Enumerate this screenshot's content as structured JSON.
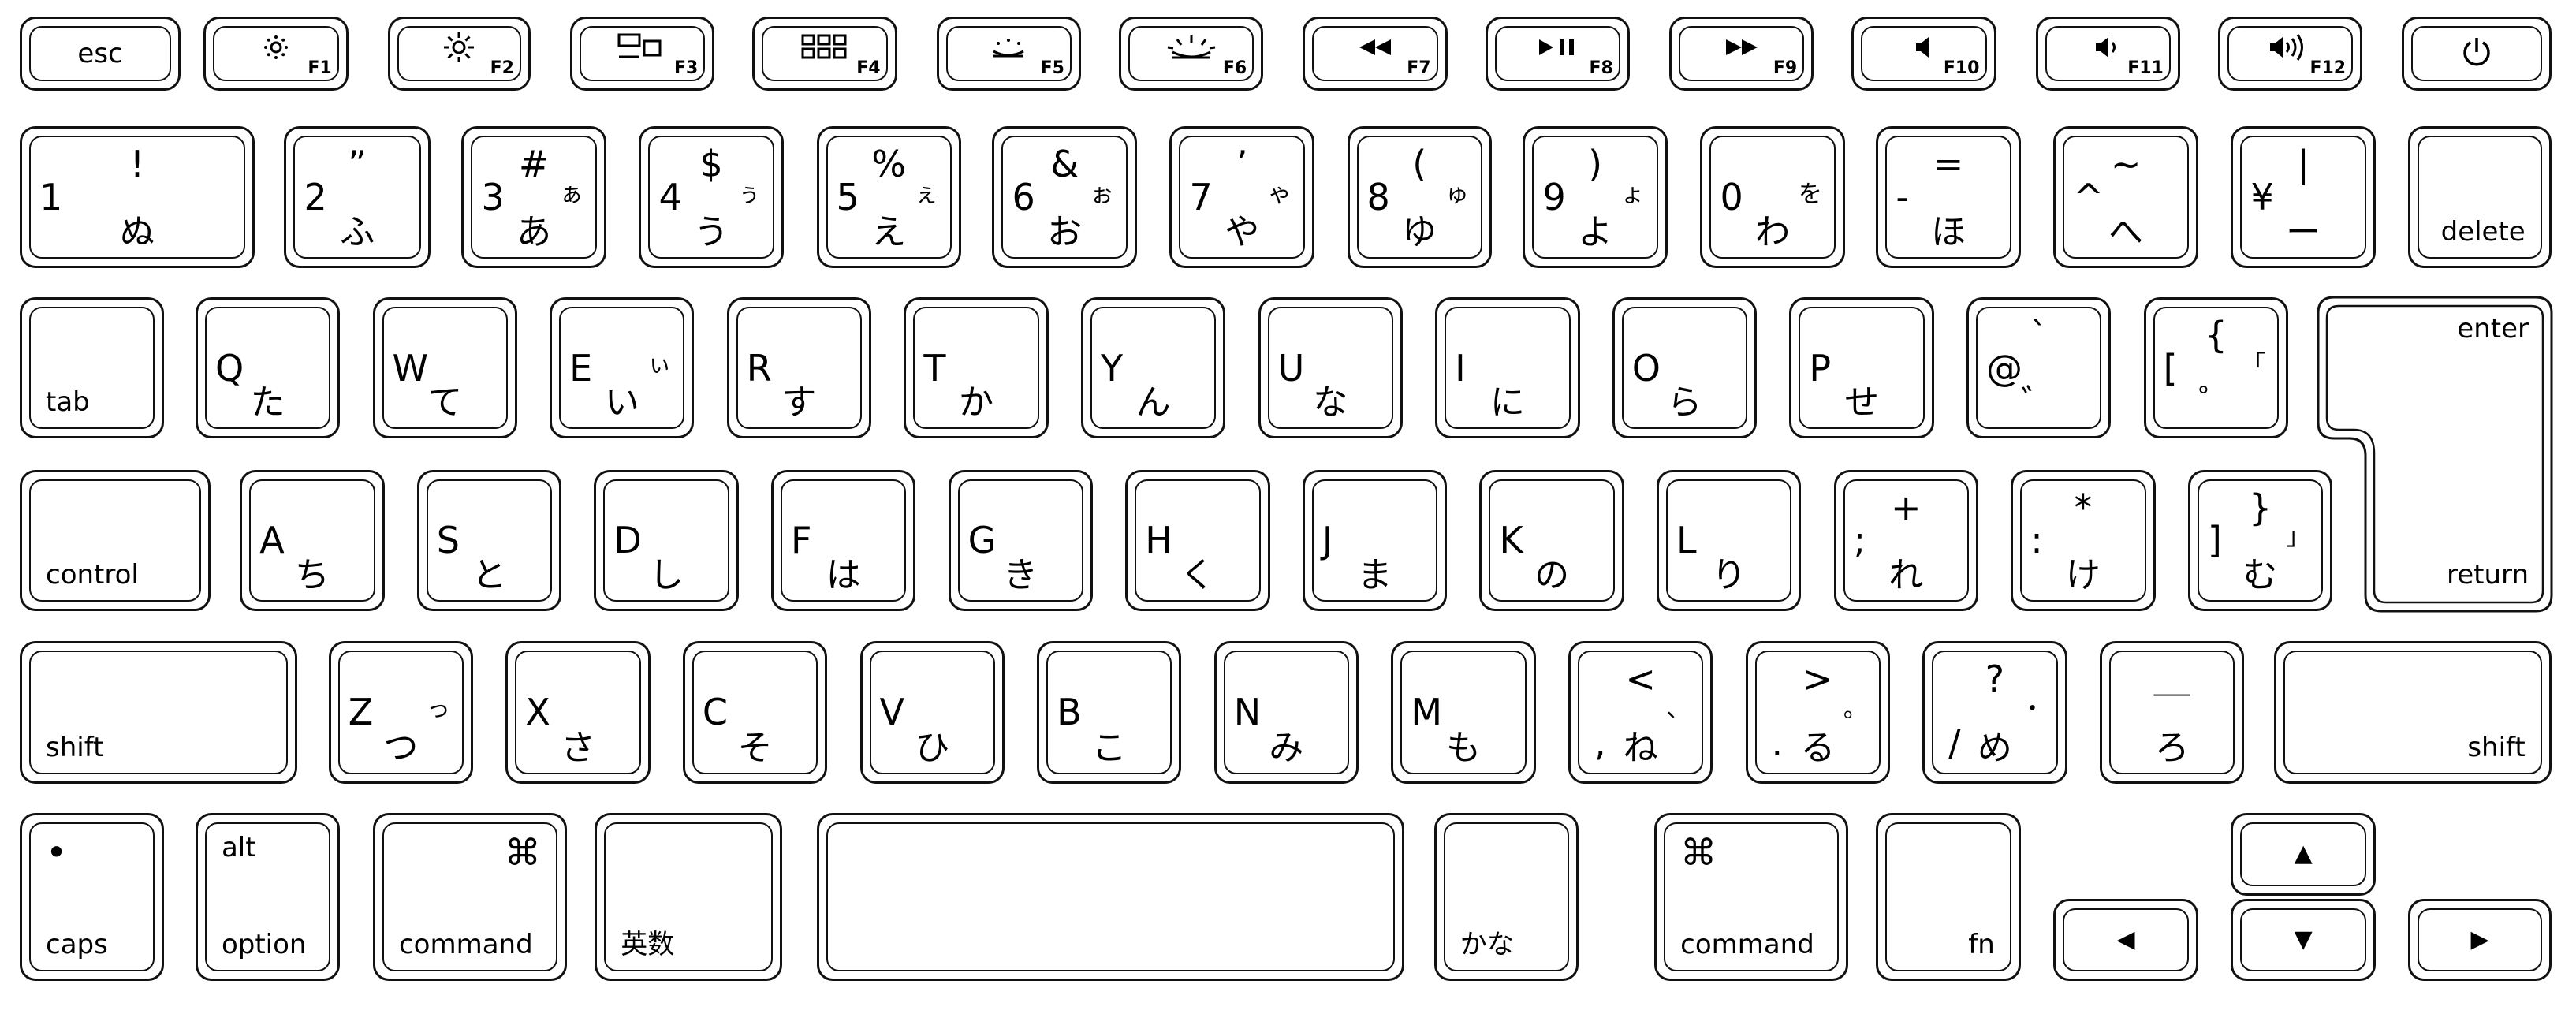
{
  "keyboard_layout": "Japanese JIS",
  "rows": [
    [
      {
        "name": "esc",
        "labels": {
          "c": "esc"
        }
      },
      {
        "name": "f1",
        "icon": "brightness-down-icon",
        "labels": {
          "fn": "F1"
        }
      },
      {
        "name": "f2",
        "icon": "brightness-up-icon",
        "labels": {
          "fn": "F2"
        }
      },
      {
        "name": "f3",
        "icon": "mission-control-icon",
        "labels": {
          "fn": "F3"
        }
      },
      {
        "name": "f4",
        "icon": "launchpad-icon",
        "labels": {
          "fn": "F4"
        }
      },
      {
        "name": "f5",
        "icon": "keyboard-light-down-icon",
        "labels": {
          "fn": "F5"
        }
      },
      {
        "name": "f6",
        "icon": "keyboard-light-up-icon",
        "labels": {
          "fn": "F6"
        }
      },
      {
        "name": "f7",
        "icon": "rewind-icon",
        "labels": {
          "fn": "F7"
        }
      },
      {
        "name": "f8",
        "icon": "play-pause-icon",
        "labels": {
          "fn": "F8"
        }
      },
      {
        "name": "f9",
        "icon": "fast-forward-icon",
        "labels": {
          "fn": "F9"
        }
      },
      {
        "name": "f10",
        "icon": "mute-icon",
        "labels": {
          "fn": "F10"
        }
      },
      {
        "name": "f11",
        "icon": "volume-down-icon",
        "labels": {
          "fn": "F11"
        }
      },
      {
        "name": "f12",
        "icon": "volume-up-icon",
        "labels": {
          "fn": "F12"
        }
      },
      {
        "name": "power",
        "icon": "power-icon",
        "labels": {}
      }
    ],
    [
      {
        "name": "1",
        "labels": {
          "tc": "!",
          "ml": "1",
          "bc": "ぬ"
        }
      },
      {
        "name": "2",
        "labels": {
          "tc": "”",
          "ml": "2",
          "bc": "ふ"
        }
      },
      {
        "name": "3",
        "labels": {
          "tc": "#",
          "ml": "3",
          "bc": "あ",
          "mr": "ぁ"
        }
      },
      {
        "name": "4",
        "labels": {
          "tc": "$",
          "ml": "4",
          "bc": "う",
          "mr": "ぅ"
        }
      },
      {
        "name": "5",
        "labels": {
          "tc": "%",
          "ml": "5",
          "bc": "え",
          "mr": "ぇ"
        }
      },
      {
        "name": "6",
        "labels": {
          "tc": "&",
          "ml": "6",
          "bc": "お",
          "mr": "ぉ"
        }
      },
      {
        "name": "7",
        "labels": {
          "tc": "’",
          "ml": "7",
          "bc": "や",
          "mr": "ゃ"
        }
      },
      {
        "name": "8",
        "labels": {
          "tc": "(",
          "ml": "8",
          "bc": "ゆ",
          "mr": "ゅ"
        }
      },
      {
        "name": "9",
        "labels": {
          "tc": ")",
          "ml": "9",
          "bc": "よ",
          "mr": "ょ"
        }
      },
      {
        "name": "0",
        "labels": {
          "ml": "0",
          "bc": "わ",
          "mr": "を"
        }
      },
      {
        "name": "minus",
        "labels": {
          "tc": "=",
          "ml": "-",
          "bc": "ほ"
        }
      },
      {
        "name": "caret",
        "labels": {
          "tc": "~",
          "ml": "^",
          "bc": "へ"
        }
      },
      {
        "name": "yen",
        "labels": {
          "tc": "|",
          "ml": "¥",
          "bc": "ー"
        }
      },
      {
        "name": "delete",
        "labels": {
          "br": "delete"
        }
      }
    ],
    [
      {
        "name": "tab",
        "labels": {
          "bl": "tab"
        }
      },
      {
        "name": "q",
        "labels": {
          "ml": "Q",
          "bc": "た"
        }
      },
      {
        "name": "w",
        "labels": {
          "ml": "W",
          "bc": "て"
        }
      },
      {
        "name": "e",
        "labels": {
          "ml": "E",
          "bc": "い",
          "mr": "ぃ"
        }
      },
      {
        "name": "r",
        "labels": {
          "ml": "R",
          "bc": "す"
        }
      },
      {
        "name": "t",
        "labels": {
          "ml": "T",
          "bc": "か"
        }
      },
      {
        "name": "y",
        "labels": {
          "ml": "Y",
          "bc": "ん"
        }
      },
      {
        "name": "u",
        "labels": {
          "ml": "U",
          "bc": "な"
        }
      },
      {
        "name": "i",
        "labels": {
          "ml": "I",
          "bc": "に"
        }
      },
      {
        "name": "o",
        "labels": {
          "ml": "O",
          "bc": "ら"
        }
      },
      {
        "name": "p",
        "labels": {
          "ml": "P",
          "bc": "せ"
        }
      },
      {
        "name": "at",
        "labels": {
          "tc": "`",
          "ml": "@",
          "bc": "゛"
        }
      },
      {
        "name": "bracket-left",
        "labels": {
          "tc": "{",
          "ml": "[",
          "mr": "「",
          "bc": "゜"
        }
      }
    ],
    [
      {
        "name": "control",
        "labels": {
          "bl": "control"
        }
      },
      {
        "name": "a",
        "labels": {
          "ml": "A",
          "bc": "ち"
        }
      },
      {
        "name": "s",
        "labels": {
          "ml": "S",
          "bc": "と"
        }
      },
      {
        "name": "d",
        "labels": {
          "ml": "D",
          "bc": "し"
        }
      },
      {
        "name": "f",
        "labels": {
          "ml": "F",
          "bc": "は"
        }
      },
      {
        "name": "g",
        "labels": {
          "ml": "G",
          "bc": "き"
        }
      },
      {
        "name": "h",
        "labels": {
          "ml": "H",
          "bc": "く"
        }
      },
      {
        "name": "j",
        "labels": {
          "ml": "J",
          "bc": "ま"
        }
      },
      {
        "name": "k",
        "labels": {
          "ml": "K",
          "bc": "の"
        }
      },
      {
        "name": "l",
        "labels": {
          "ml": "L",
          "bc": "り"
        }
      },
      {
        "name": "semicolon",
        "labels": {
          "tc": "+",
          "ml": ";",
          "bc": "れ"
        }
      },
      {
        "name": "colon",
        "labels": {
          "tc": "*",
          "ml": ":",
          "bc": "け"
        }
      },
      {
        "name": "bracket-right",
        "labels": {
          "tc": "}",
          "ml": "]",
          "mr": "」",
          "bc": "む"
        }
      }
    ],
    [
      {
        "name": "shift-left",
        "labels": {
          "bl": "shift"
        }
      },
      {
        "name": "z",
        "labels": {
          "ml": "Z",
          "bc": "つ",
          "mr": "っ"
        }
      },
      {
        "name": "x",
        "labels": {
          "ml": "X",
          "bc": "さ"
        }
      },
      {
        "name": "c",
        "labels": {
          "ml": "C",
          "bc": "そ"
        }
      },
      {
        "name": "v",
        "labels": {
          "ml": "V",
          "bc": "ひ"
        }
      },
      {
        "name": "b",
        "labels": {
          "ml": "B",
          "bc": "こ"
        }
      },
      {
        "name": "n",
        "labels": {
          "ml": "N",
          "bc": "み"
        }
      },
      {
        "name": "m",
        "labels": {
          "ml": "M",
          "bc": "も"
        }
      },
      {
        "name": "comma",
        "labels": {
          "tc": "<",
          "bl": ",",
          "bc": "ね",
          "mr": "、"
        }
      },
      {
        "name": "period",
        "labels": {
          "tc": ">",
          "bl": ".",
          "bc": "る",
          "mr": "。"
        }
      },
      {
        "name": "slash",
        "labels": {
          "tc": "?",
          "bl": "/",
          "bc": "め",
          "mr": "・"
        }
      },
      {
        "name": "ro",
        "labels": {
          "tc": "＿",
          "bc": "ろ"
        }
      },
      {
        "name": "shift-right",
        "labels": {
          "br": "shift"
        }
      }
    ],
    [
      {
        "name": "caps-lock",
        "labels": {
          "tl": "•",
          "bl": "caps"
        }
      },
      {
        "name": "option",
        "labels": {
          "tl": "alt",
          "bl": "option"
        }
      },
      {
        "name": "command-left",
        "labels": {
          "tr": "⌘",
          "bl": "command"
        }
      },
      {
        "name": "eisu",
        "labels": {
          "bl": "英数"
        }
      },
      {
        "name": "space",
        "labels": {}
      },
      {
        "name": "kana",
        "labels": {
          "bl": "かな"
        }
      },
      {
        "name": "command-right",
        "labels": {
          "tl": "⌘",
          "bl": "command"
        }
      },
      {
        "name": "fn",
        "labels": {
          "br": "fn"
        }
      },
      {
        "name": "arrow-left",
        "labels": {
          "c": "◀"
        }
      },
      {
        "name": "arrow-up",
        "labels": {
          "c": "▲"
        }
      },
      {
        "name": "arrow-down",
        "labels": {
          "c": "▼"
        }
      },
      {
        "name": "arrow-right",
        "labels": {
          "c": "▶"
        }
      }
    ]
  ],
  "enter_key": {
    "top_label": "enter",
    "bottom_label": "return"
  }
}
